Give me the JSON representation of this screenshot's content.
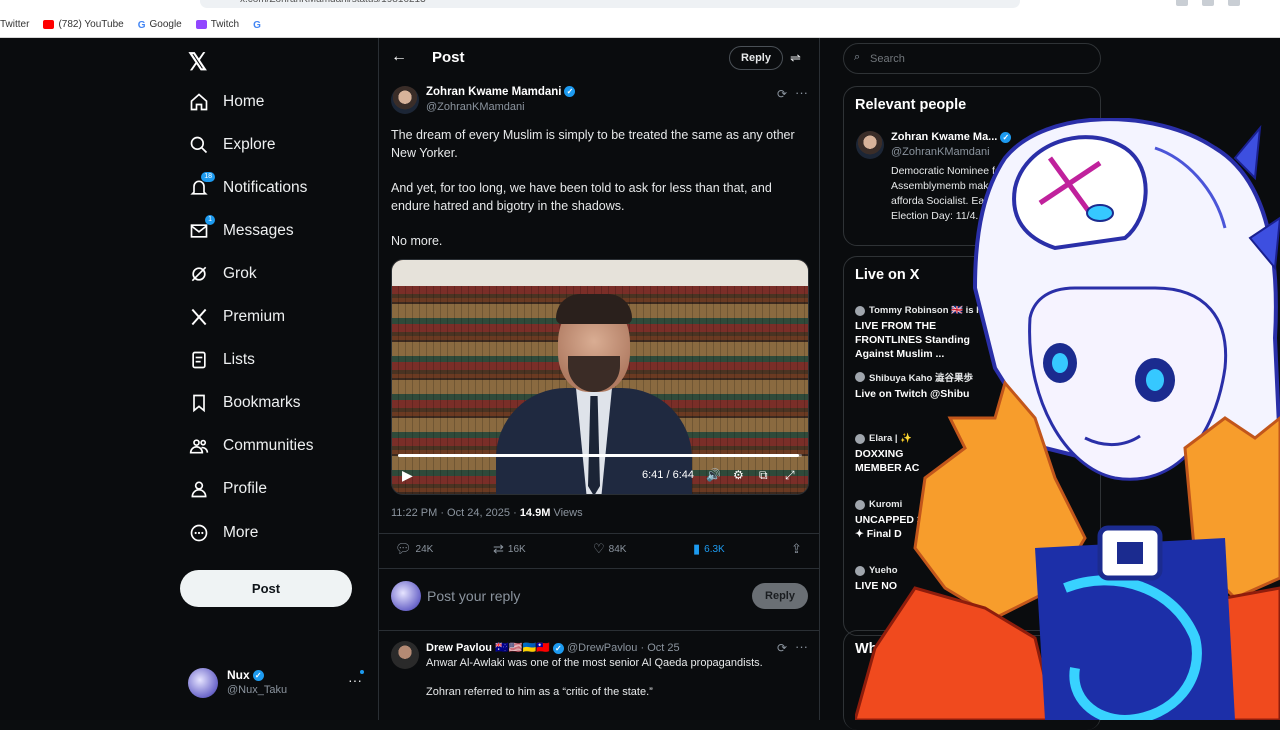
{
  "browser": {
    "url": "x.com/ZohranKMamdani/status/19816213",
    "bookmarks": [
      {
        "label": "Twitter",
        "color": "#ffffff"
      },
      {
        "label": "(782) YouTube",
        "color": "#ff0000"
      },
      {
        "label": "Google",
        "color": "#4285f4"
      },
      {
        "label": "Twitch",
        "color": "#9146ff"
      },
      {
        "label": "",
        "color": "#4285f4"
      }
    ]
  },
  "nav": {
    "logo": "𝕏",
    "items": [
      {
        "label": "Home",
        "icon": "home-icon"
      },
      {
        "label": "Explore",
        "icon": "search-icon"
      },
      {
        "label": "Notifications",
        "icon": "bell-icon",
        "badge": "18"
      },
      {
        "label": "Messages",
        "icon": "envelope-icon",
        "badge": "1"
      },
      {
        "label": "Grok",
        "icon": "grok-icon"
      },
      {
        "label": "Premium",
        "icon": "x-logo-icon"
      },
      {
        "label": "Lists",
        "icon": "list-icon"
      },
      {
        "label": "Bookmarks",
        "icon": "bookmark-icon"
      },
      {
        "label": "Communities",
        "icon": "people-icon"
      },
      {
        "label": "Profile",
        "icon": "person-icon"
      },
      {
        "label": "More",
        "icon": "more-circle-icon"
      }
    ],
    "post_label": "Post",
    "account": {
      "name": "Nux",
      "handle": "@Nux_Taku",
      "more": "···"
    }
  },
  "main": {
    "title": "Post",
    "reply_label": "Reply",
    "author": {
      "name": "Zohran Kwame Mamdani",
      "handle": "@ZohranKMamdani"
    },
    "paragraphs": [
      "The dream of every Muslim is simply to be treated the same as any other New Yorker.",
      "And yet, for too long, we have been told to ask for less than that, and endure hatred and bigotry in the shadows.",
      "No more."
    ],
    "video": {
      "time": "6:41 / 6:44",
      "progress": 0.992
    },
    "meta": {
      "timestamp": "11:22 PM · Oct 24, 2025 · ",
      "views_count": "14.9M",
      "views_label": " Views"
    },
    "actions": {
      "replies": "24K",
      "reposts": "16K",
      "likes": "84K",
      "bookmarks": "6.3K"
    },
    "compose": {
      "placeholder": "Post your reply",
      "button": "Reply"
    },
    "comment": {
      "name": "Drew Pavlou",
      "flags": "🇦🇺🇺🇸🇺🇦🇹🇼",
      "handle": "@DrewPavlou · Oct 25",
      "line1": "Anwar Al-Awlaki was one of the most senior Al Qaeda propagandists.",
      "line2": "Zohran referred to him as a “critic of the state.”"
    }
  },
  "right": {
    "search_placeholder": "Search",
    "relevant": {
      "title": "Relevant people",
      "name": "Zohran Kwame Ma...",
      "handle": "@ZohranKMamdani",
      "bio": "Democratic Nominee fo NYC. Assemblymemb make this city afforda Socialist. Early Votin Election Day: 11/4."
    },
    "live": {
      "title": "Live on X",
      "items": [
        {
          "who": "Tommy Robinson 🇬🇧 is ho",
          "title": "LIVE FROM THE FRONTLINES Standing Against Muslim ..."
        },
        {
          "who": "Shibuya Kaho 澁谷果歩",
          "title": "Live on Twitch @Shibu"
        },
        {
          "who": "Elara | ✨",
          "title": "DOXXING MEMBER AC"
        },
        {
          "who": "Kuromi",
          "title": "UNCAPPED 38 ✦ Final D"
        },
        {
          "who": "Yueho",
          "title": "LIVE NO"
        }
      ]
    },
    "who_to_follow": "Wh"
  }
}
